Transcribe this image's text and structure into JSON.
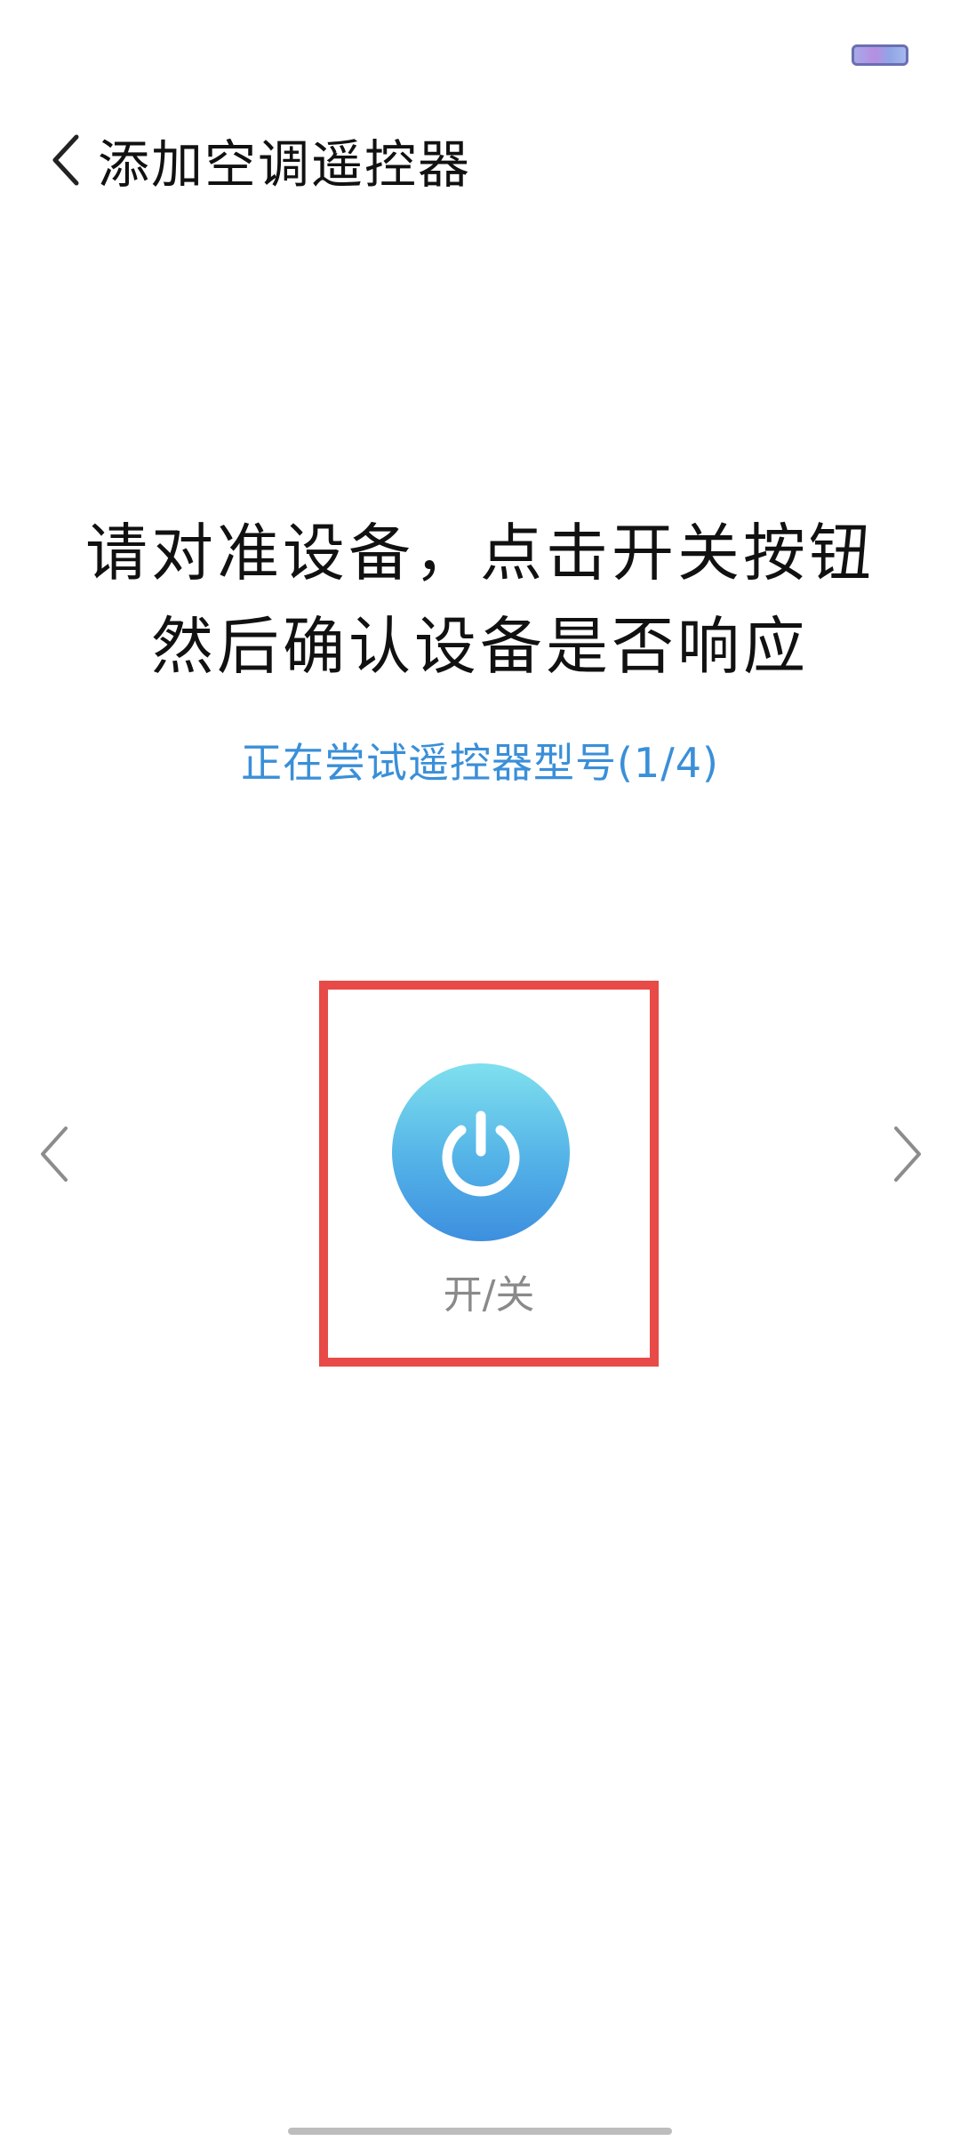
{
  "header": {
    "back_icon": "chevron-left-icon",
    "title": "添加空调遥控器"
  },
  "instruction": {
    "line1": "请对准设备，点击开关按钮",
    "line2": "然后确认设备是否响应"
  },
  "status": {
    "trying_model": "正在尝试遥控器型号(1/4)"
  },
  "remote": {
    "power_icon": "power-icon",
    "power_label": "开/关"
  },
  "navigation": {
    "prev_icon": "chevron-left-icon",
    "next_icon": "chevron-right-icon"
  },
  "colors": {
    "accent_blue": "#3a8fd8",
    "highlight_red": "#e84a47",
    "button_gradient_top": "#7fe0ee",
    "button_gradient_bottom": "#3d8fdf"
  }
}
